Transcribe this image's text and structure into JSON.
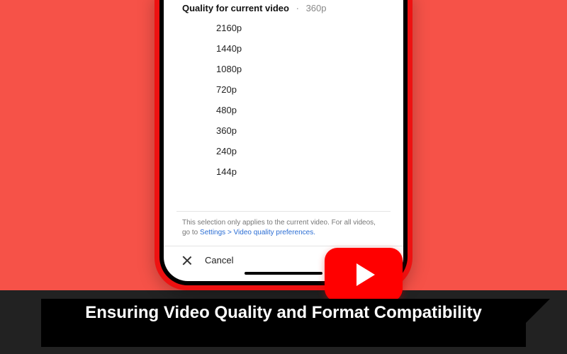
{
  "header": {
    "title": "Quality for current video",
    "current": "360p"
  },
  "options": [
    "2160p",
    "1440p",
    "1080p",
    "720p",
    "480p",
    "360p",
    "240p",
    "144p"
  ],
  "note": {
    "text": "This selection only applies to the current video. For all videos, go to ",
    "link": "Settings > Video quality preferences."
  },
  "cancel": "Cancel",
  "banner": "Ensuring Video Quality and Format Compatibility"
}
